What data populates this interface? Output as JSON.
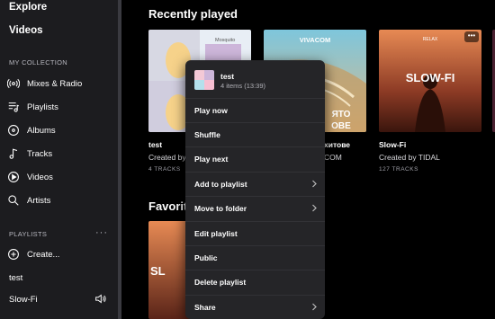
{
  "sidebar": {
    "explore": "Explore",
    "videos_top": "Videos",
    "my_collection": "MY COLLECTION",
    "items": [
      {
        "label": "Mixes & Radio",
        "icon": "radio-icon"
      },
      {
        "label": "Playlists",
        "icon": "playlist-icon"
      },
      {
        "label": "Albums",
        "icon": "album-icon"
      },
      {
        "label": "Tracks",
        "icon": "note-icon"
      },
      {
        "label": "Videos",
        "icon": "video-icon"
      },
      {
        "label": "Artists",
        "icon": "artist-icon"
      }
    ],
    "playlists_head": "PLAYLISTS",
    "more": "···",
    "create": "Create...",
    "playlist_names": [
      "test",
      "Slow-Fi"
    ]
  },
  "main": {
    "recently_played": "Recently played",
    "favorites": "Favorite",
    "cards": [
      {
        "title": "test",
        "sub": "Created by",
        "meta": "4 TRACKS"
      },
      {
        "title": "хитове",
        "sub": "COM",
        "meta": "",
        "brand": "VIVACOM",
        "art_text": "ЛЯТО\nТОВЕ"
      },
      {
        "title": "Slow-Fi",
        "sub": "Created by TIDAL",
        "meta": "127 TRACKS",
        "art_text": "SLOW-FI",
        "badge": "RELAX"
      }
    ],
    "fav_art_text": "SL",
    "thumb_labels": [
      "Mosquito"
    ]
  },
  "context_menu": {
    "title": "test",
    "subtitle": "4 items (13:39)",
    "items": [
      {
        "label": "Play now",
        "submenu": false
      },
      {
        "label": "Shuffle",
        "submenu": false
      },
      {
        "label": "Play next",
        "submenu": false
      },
      {
        "label": "Add to playlist",
        "submenu": true
      },
      {
        "label": "Move to folder",
        "submenu": true
      },
      {
        "label": "Edit playlist",
        "submenu": false
      },
      {
        "label": "Public",
        "submenu": false
      },
      {
        "label": "Delete playlist",
        "submenu": false
      },
      {
        "label": "Share",
        "submenu": true
      }
    ]
  },
  "colors": {
    "background": "#000000",
    "sidebar": "#1c1c1f",
    "menu": "#252528"
  }
}
